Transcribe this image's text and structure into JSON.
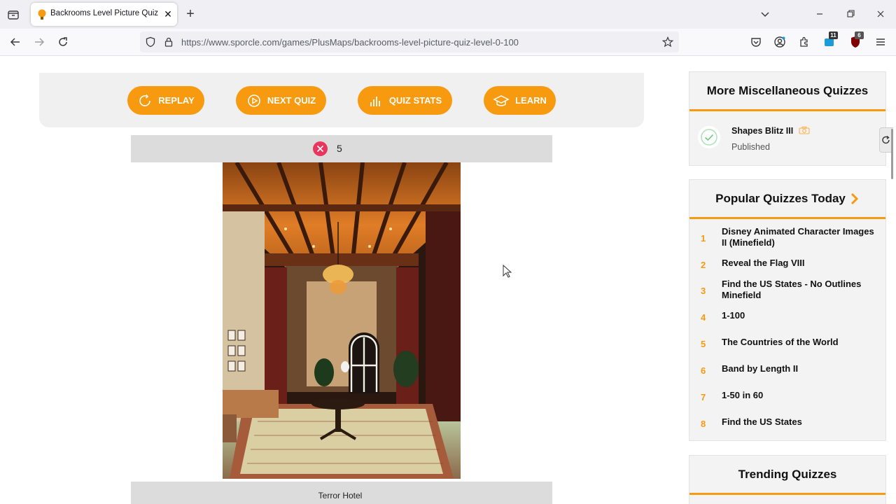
{
  "browser": {
    "tab_title": "Backrooms Level Picture Quiz (L",
    "url": "https://www.sporcle.com/games/PlusMaps/backrooms-level-picture-quiz-level-0-100",
    "extension_badges": [
      "11",
      "6"
    ]
  },
  "quiz_actions": {
    "replay": "REPLAY",
    "next_quiz": "NEXT QUIZ",
    "quiz_stats": "QUIZ STATS",
    "learn": "LEARN"
  },
  "result": {
    "wrong_count": "5",
    "answer": "Terror Hotel"
  },
  "sidebar": {
    "misc": {
      "heading": "More Miscellaneous Quizzes",
      "item_title": "Shapes Blitz III",
      "item_status": "Published"
    },
    "popular": {
      "heading": "Popular Quizzes Today",
      "items": [
        {
          "num": "1",
          "label": "Disney Animated Character Images II (Minefield)"
        },
        {
          "num": "2",
          "label": "Reveal the Flag VIII"
        },
        {
          "num": "3",
          "label": "Find the US States - No Outlines Minefield"
        },
        {
          "num": "4",
          "label": "1-100"
        },
        {
          "num": "5",
          "label": "The Countries of the World"
        },
        {
          "num": "6",
          "label": "Band by Length II"
        },
        {
          "num": "7",
          "label": "1-50 in 60"
        },
        {
          "num": "8",
          "label": "Find the US States"
        }
      ]
    },
    "trending": {
      "heading": "Trending Quizzes"
    }
  },
  "colors": {
    "accent": "#f79a0f",
    "wrong": "#e8365d"
  }
}
